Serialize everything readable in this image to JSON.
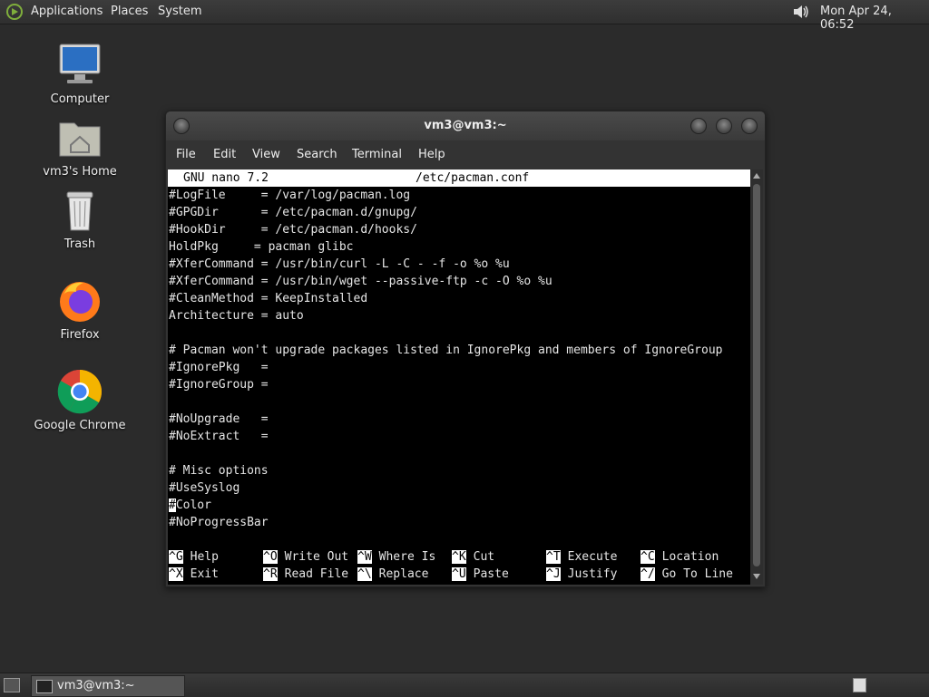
{
  "top_panel": {
    "menus": [
      "Applications",
      "Places",
      "System"
    ],
    "clock": "Mon Apr 24, 06:52"
  },
  "desktop": {
    "icons": [
      {
        "label": "Computer",
        "icon": "computer-icon"
      },
      {
        "label": "vm3's Home",
        "icon": "home-folder-icon"
      },
      {
        "label": "Trash",
        "icon": "trash-icon"
      },
      {
        "label": "Firefox",
        "icon": "firefox-icon"
      },
      {
        "label": "Google Chrome",
        "icon": "chrome-icon"
      }
    ]
  },
  "terminal": {
    "title": "vm3@vm3:~",
    "menus": [
      "File",
      "Edit",
      "View",
      "Search",
      "Terminal",
      "Help"
    ],
    "nano_header": {
      "app": "GNU nano 7.2",
      "file": "/etc/pacman.conf"
    },
    "lines": [
      "#LogFile     = /var/log/pacman.log",
      "#GPGDir      = /etc/pacman.d/gnupg/",
      "#HookDir     = /etc/pacman.d/hooks/",
      "HoldPkg     = pacman glibc",
      "#XferCommand = /usr/bin/curl -L -C - -f -o %o %u",
      "#XferCommand = /usr/bin/wget --passive-ftp -c -O %o %u",
      "#CleanMethod = KeepInstalled",
      "Architecture = auto",
      "",
      "# Pacman won't upgrade packages listed in IgnorePkg and members of IgnoreGroup",
      "#IgnorePkg   =",
      "#IgnoreGroup =",
      "",
      "#NoUpgrade   =",
      "#NoExtract   =",
      "",
      "# Misc options",
      "#UseSyslog",
      "#Color",
      "#NoProgressBar"
    ],
    "cursor_line_index": 18,
    "shortcuts": [
      [
        {
          "key": "^G",
          "label": "Help"
        },
        {
          "key": "^O",
          "label": "Write Out"
        },
        {
          "key": "^W",
          "label": "Where Is"
        },
        {
          "key": "^K",
          "label": "Cut"
        },
        {
          "key": "^T",
          "label": "Execute"
        },
        {
          "key": "^C",
          "label": "Location"
        }
      ],
      [
        {
          "key": "^X",
          "label": "Exit"
        },
        {
          "key": "^R",
          "label": "Read File"
        },
        {
          "key": "^\\",
          "label": "Replace"
        },
        {
          "key": "^U",
          "label": "Paste"
        },
        {
          "key": "^J",
          "label": "Justify"
        },
        {
          "key": "^/",
          "label": "Go To Line"
        }
      ]
    ]
  },
  "taskbar": {
    "task_label": "vm3@vm3:~"
  }
}
